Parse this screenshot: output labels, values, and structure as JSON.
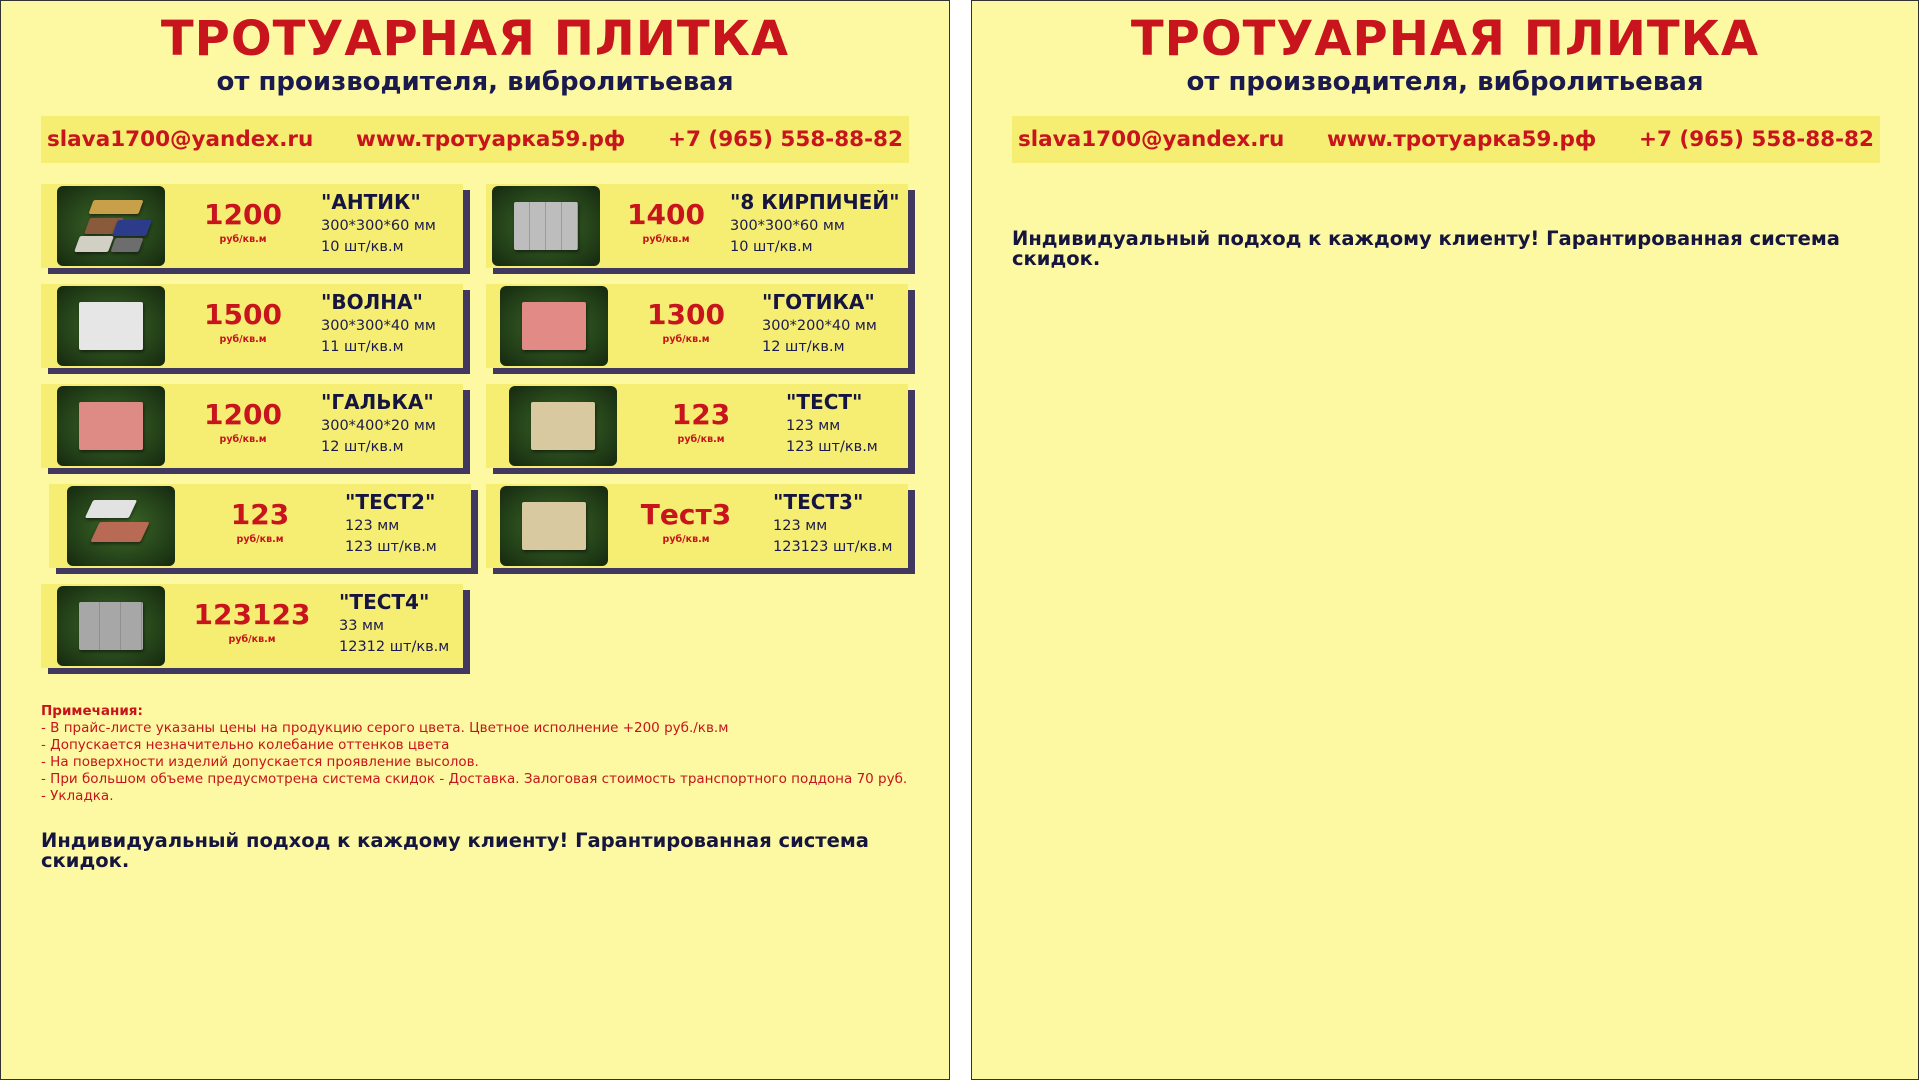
{
  "header": {
    "title": "ТРОТУАРНАЯ ПЛИТКА",
    "subtitle": "от производителя, вибролитьевая"
  },
  "contacts": {
    "email": "slava1700@yandex.ru",
    "website": "www.тротуарка59.рф",
    "phone": "+7 (965) 558-88-82"
  },
  "unit_label": "руб/кв.м",
  "products": [
    {
      "price": "1200",
      "name": "\"АНТИК\"",
      "size": "300*300*60 мм",
      "per_sqm": "10 шт/кв.м",
      "image_icon": "multicolor-tile-icon"
    },
    {
      "price": "1400",
      "name": "\"8 КИРПИЧЕЙ\"",
      "size": "300*300*60 мм",
      "per_sqm": "10 шт/кв.м",
      "image_icon": "gray-brick-tile-icon"
    },
    {
      "price": "1500",
      "name": "\"ВОЛНА\"",
      "size": "300*300*40 мм",
      "per_sqm": "11 шт/кв.м",
      "image_icon": "white-wave-tile-icon"
    },
    {
      "price": "1300",
      "name": "\"ГОТИКА\"",
      "size": "300*200*40 мм",
      "per_sqm": "12 шт/кв.м",
      "image_icon": "red-gothic-tile-icon"
    },
    {
      "price": "1200",
      "name": "\"ГАЛЬКА\"",
      "size": "300*400*20 мм",
      "per_sqm": "12 шт/кв.м",
      "image_icon": "red-pebble-tile-icon"
    },
    {
      "price": "123",
      "name": "\"ТЕСТ\"",
      "size": "123 мм",
      "per_sqm": "123 шт/кв.м",
      "image_icon": "beige-tile-icon"
    },
    {
      "price": "123",
      "name": "\"ТЕСТ2\"",
      "size": "123 мм",
      "per_sqm": "123 шт/кв.м",
      "image_icon": "interlock-tile-icon"
    },
    {
      "price": "Тест3",
      "name": "\"ТЕСТ3\"",
      "size": "123 мм",
      "per_sqm": "123123 шт/кв.м",
      "image_icon": "beige-tile-icon"
    },
    {
      "price": "123123",
      "name": "\"ТЕСТ4\"",
      "size": "33 мм",
      "per_sqm": "12312 шт/кв.м",
      "image_icon": "gray-tile-icon"
    }
  ],
  "notes": {
    "heading": "Примечания:",
    "items": [
      "- В прайс-листе указаны цены на продукцию серого цвета. Цветное исполнение +200 руб./кв.м",
      "- Допускается незначительно колебание оттенков цвета",
      "- На поверхности изделий допускается проявление высолов.",
      "- При большом объеме предусмотрена система скидок - Доставка. Залоговая стоимость транспортного поддона 70 руб.",
      "- Укладка."
    ]
  },
  "tagline": "Индивидуальный подход к каждому клиенту! Гарантированная система скидок.",
  "colors": {
    "page_background": "#fcf9a2",
    "card_background": "#f5ee72",
    "accent_red": "#c8141c",
    "navy_text": "#15153f",
    "shadow": "#40385f"
  }
}
